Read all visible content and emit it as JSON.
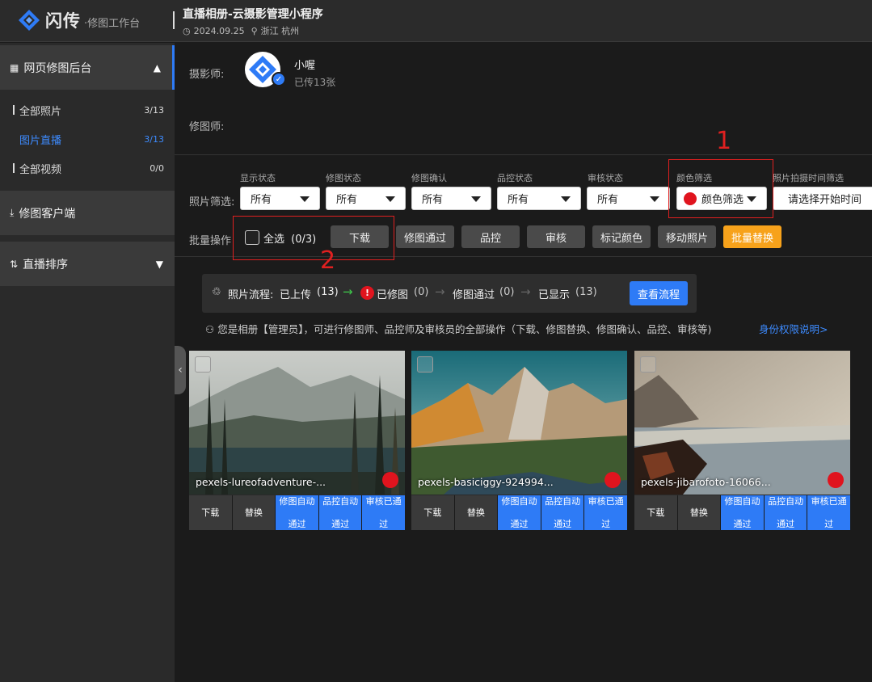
{
  "app": {
    "brand": "闪传",
    "brand_sub": "·修图工作台",
    "album_title": "直播相册-云摄影管理小程序",
    "album_date": "2024.09.25",
    "album_location": "浙江 杭州"
  },
  "sidebar": {
    "web_backend": "网页修图后台",
    "items": [
      {
        "label": "全部照片",
        "count": "3/13"
      },
      {
        "label": "图片直播",
        "count": "3/13"
      },
      {
        "label": "全部视频",
        "count": "0/0"
      }
    ],
    "client": "修图客户端",
    "live_sort": "直播排序"
  },
  "people": {
    "photographer_label": "摄影师:",
    "photographer_name": "小喔",
    "photographer_uploaded": "已传13张",
    "retoucher_label": "修图师:"
  },
  "filters": {
    "label": "照片筛选:",
    "captions": [
      "显示状态",
      "修图状态",
      "修图确认",
      "品控状态",
      "审核状态",
      "颜色筛选",
      "照片拍摄时间筛选"
    ],
    "values": [
      "所有",
      "所有",
      "所有",
      "所有",
      "所有",
      "颜色筛选",
      "请选择开始时间"
    ]
  },
  "batch": {
    "label": "批量操作",
    "select_all": "全选",
    "select_count": "(0/3)",
    "buttons": [
      "下载",
      "修图通过",
      "品控",
      "审核",
      "标记颜色",
      "移动照片",
      "批量替换"
    ]
  },
  "annotations": [
    "1",
    "2"
  ],
  "flow": {
    "prefix": "照片流程:",
    "steps": [
      {
        "label": "已上传",
        "count": "(13)"
      },
      {
        "label": "已修图",
        "count": "(0)"
      },
      {
        "label": "修图通过",
        "count": "(0)"
      },
      {
        "label": "已显示",
        "count": "(13)"
      }
    ],
    "view_button": "查看流程",
    "notice": "您是相册【管理员】，可进行修图师、品控师及审核员的全部操作（下载、修图替换、修图确认、品控、审核等)",
    "role_link": "身份权限说明>"
  },
  "photos": [
    {
      "name": "pexels-lureofadventure-...",
      "actions": [
        "下载",
        "替换",
        "修图自动通过",
        "品控自动通过",
        "审核已通过"
      ]
    },
    {
      "name": "pexels-basiciggy-924994...",
      "actions": [
        "下载",
        "替换",
        "修图自动通过",
        "品控自动通过",
        "审核已通过"
      ]
    },
    {
      "name": "pexels-jibarofoto-16066...",
      "actions": [
        "下载",
        "替换",
        "修图自动通过",
        "品控自动通过",
        "审核已通过"
      ]
    }
  ],
  "colors": {
    "accent": "#2e7bf6",
    "orange": "#f7a21b",
    "red": "#e0141e"
  }
}
